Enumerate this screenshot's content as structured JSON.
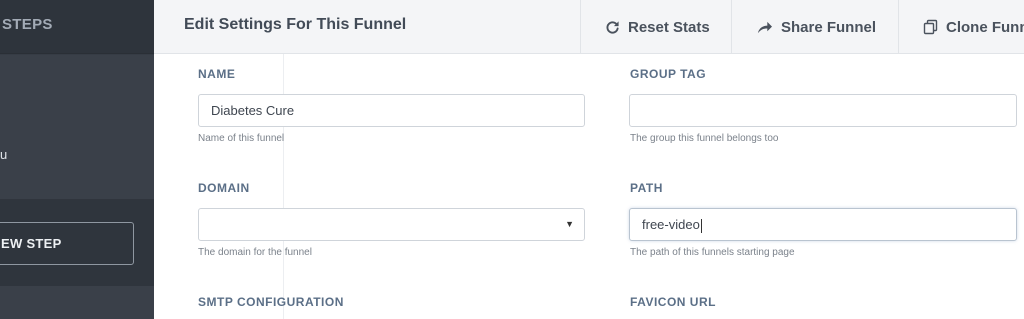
{
  "sidebar": {
    "title": "STEPS",
    "step_text": "u",
    "new_step_label": "EW STEP"
  },
  "header": {
    "title": "Edit Settings For This Funnel",
    "reset_label": "Reset Stats",
    "share_label": "Share Funnel",
    "clone_label": "Clone Funn"
  },
  "form": {
    "name": {
      "label": "NAME",
      "value": "Diabetes Cure",
      "help": "Name of this funnel"
    },
    "group_tag": {
      "label": "GROUP TAG",
      "value": "",
      "help": "The group this funnel belongs too"
    },
    "domain": {
      "label": "DOMAIN",
      "value": "",
      "caret": "▼",
      "help": "The domain for the funnel"
    },
    "path": {
      "label": "PATH",
      "value": "free-video",
      "help": "The path of this funnels starting page"
    },
    "smtp": {
      "label": "SMTP CONFIGURATION"
    },
    "favicon": {
      "label": "FAVICON URL"
    }
  },
  "icons": {
    "reset": "refresh-icon",
    "share": "share-arrow-icon",
    "clone": "copy-icon"
  },
  "colors": {
    "sidebar_bg": "#363c45",
    "label_blue": "#5b6f87",
    "header_bg": "#f4f5f7"
  }
}
